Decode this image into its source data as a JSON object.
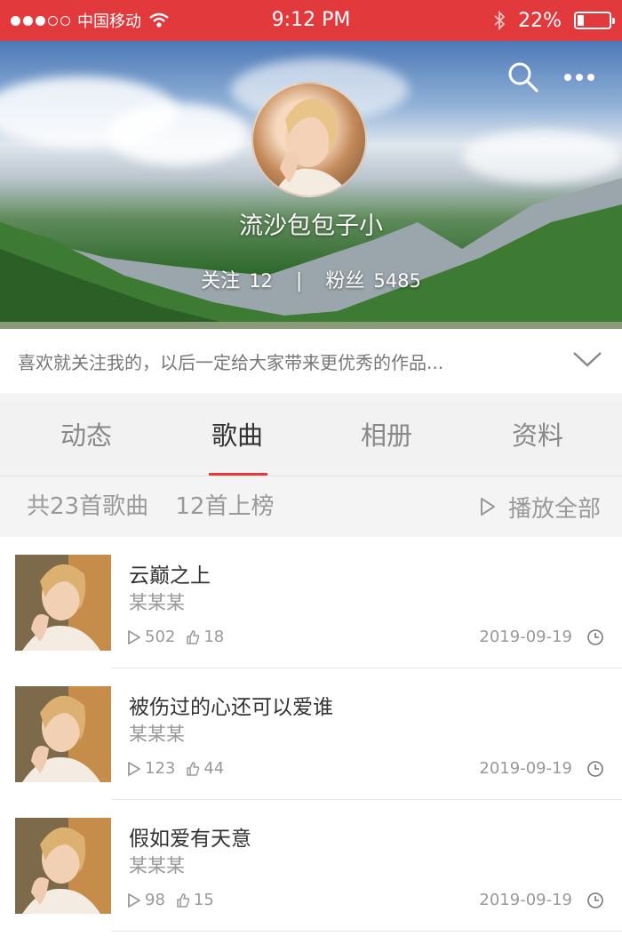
{
  "status_bar": {
    "carrier": "中国移动",
    "time": "9:12 PM",
    "battery": "22%",
    "battery_level": 0.22
  },
  "profile": {
    "username": "流沙包包子小",
    "following_label": "关注",
    "following_count": "12",
    "separator": "|",
    "fans_label": "粉丝",
    "fans_count": "5485",
    "bio": "喜欢就关注我的，以后一定给大家带来更优秀的作品..."
  },
  "tabs": [
    {
      "label": "动态"
    },
    {
      "label": "歌曲",
      "active": true
    },
    {
      "label": "相册"
    },
    {
      "label": "资料"
    }
  ],
  "summary": {
    "total": "共23首歌曲",
    "ranked": "12首上榜",
    "play_all": "播放全部"
  },
  "songs": [
    {
      "title": "云巅之上",
      "artist": "某某某",
      "plays": "502",
      "likes": "18",
      "date": "2019-09-19"
    },
    {
      "title": "被伤过的心还可以爱谁",
      "artist": "某某某",
      "plays": "123",
      "likes": "44",
      "date": "2019-09-19"
    },
    {
      "title": "假如爱有天意",
      "artist": "某某某",
      "plays": "98",
      "likes": "15",
      "date": "2019-09-19"
    }
  ],
  "colors": {
    "accent": "#e2393d",
    "text_primary": "#333333",
    "text_secondary": "#999999"
  },
  "icons": [
    "wifi-icon",
    "bluetooth-icon",
    "battery-icon",
    "search-icon",
    "more-icon",
    "chevron-down-icon",
    "play-icon",
    "thumbs-up-icon",
    "clock-icon"
  ]
}
